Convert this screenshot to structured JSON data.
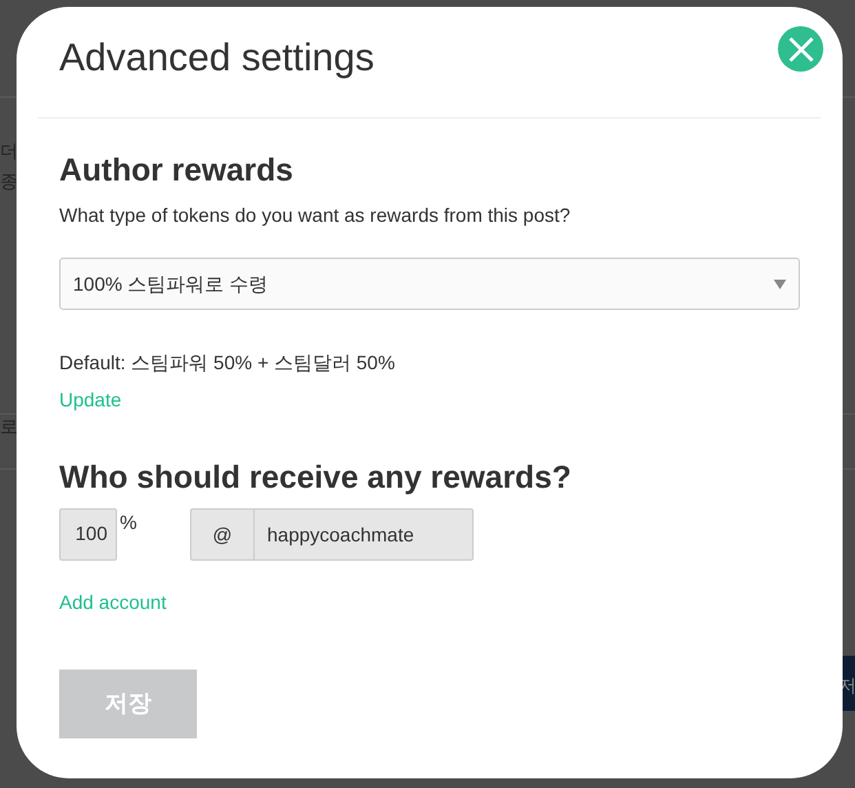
{
  "background": {
    "fragments": [
      {
        "text": "더"
      },
      {
        "text": "종"
      },
      {
        "text": "로"
      },
      {
        "text": "저"
      }
    ]
  },
  "dialog": {
    "title": "Advanced settings",
    "author_rewards": {
      "heading": "Author rewards",
      "question": "What type of tokens do you want as rewards from this post?",
      "select": {
        "value": "100% 스팀파워로 수령"
      },
      "default_note": "Default: 스팀파워 50% + 스팀달러 50%",
      "update_link": "Update"
    },
    "beneficiaries": {
      "heading": "Who should receive any rewards?",
      "rows": [
        {
          "percent": "100",
          "percent_sign": "%",
          "at_sign": "@",
          "account": "happycoachmate"
        }
      ],
      "add_link": "Add account"
    },
    "save_button": {
      "label": "저장",
      "disabled": true
    }
  }
}
